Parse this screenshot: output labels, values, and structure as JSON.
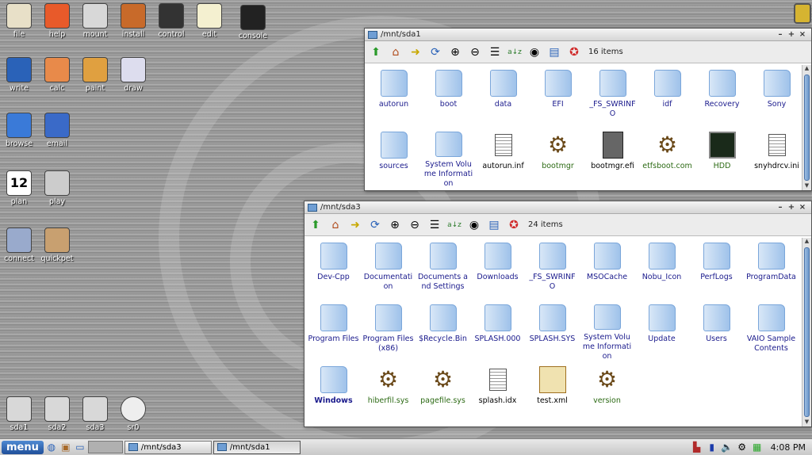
{
  "desktop_icons": [
    {
      "label": "file",
      "icon": "home-icon"
    },
    {
      "label": "help",
      "icon": "lifebuoy-icon"
    },
    {
      "label": "mount",
      "icon": "drive-icon"
    },
    {
      "label": "install",
      "icon": "package-icon"
    },
    {
      "label": "control",
      "icon": "hat-icon"
    },
    {
      "label": "edit",
      "icon": "notepad-icon"
    },
    {
      "label": "console",
      "icon": "terminal-icon"
    },
    {
      "label": "write",
      "icon": "pen-icon"
    },
    {
      "label": "calc",
      "icon": "spreadsheet-icon"
    },
    {
      "label": "paint",
      "icon": "palette-icon"
    },
    {
      "label": "draw",
      "icon": "compass-icon"
    },
    {
      "label": "browse",
      "icon": "globe-icon"
    },
    {
      "label": "email",
      "icon": "mail-icon"
    },
    {
      "label": "plan",
      "icon": "calendar-icon",
      "text": "12"
    },
    {
      "label": "play",
      "icon": "speaker-icon"
    },
    {
      "label": "connect",
      "icon": "network-icon"
    },
    {
      "label": "quickpet",
      "icon": "box-icon"
    },
    {
      "label": "sda1",
      "icon": "drive-icon"
    },
    {
      "label": "sda2",
      "icon": "drive-icon"
    },
    {
      "label": "sda3",
      "icon": "drive-icon"
    },
    {
      "label": "sr0",
      "icon": "cd-icon"
    }
  ],
  "colors": {
    "folder": "#9fc2ea",
    "directory_text": "#1a1a8c",
    "executable_text": "#2c6a14",
    "menu": "#1f4f9a"
  },
  "window_sda1": {
    "title": "/mnt/sda1",
    "count": "16 items",
    "items": [
      {
        "name": "autorun",
        "type": "folder"
      },
      {
        "name": "boot",
        "type": "folder"
      },
      {
        "name": "data",
        "type": "folder"
      },
      {
        "name": "EFI",
        "type": "folder"
      },
      {
        "name": "_FS_SWRINFO",
        "type": "folder"
      },
      {
        "name": "idf",
        "type": "folder"
      },
      {
        "name": "Recovery",
        "type": "folder"
      },
      {
        "name": "Sony",
        "type": "folder"
      },
      {
        "name": "sources",
        "type": "folder"
      },
      {
        "name": "System Volume Information",
        "type": "folder"
      },
      {
        "name": "autorun.inf",
        "type": "doc"
      },
      {
        "name": "bootmgr",
        "type": "gear"
      },
      {
        "name": "bootmgr.efi",
        "type": "binary"
      },
      {
        "name": "etfsboot.com",
        "type": "gear"
      },
      {
        "name": "HDD",
        "type": "terminal"
      },
      {
        "name": "snyhdrcv.ini",
        "type": "doc"
      }
    ]
  },
  "window_sda3": {
    "title": "/mnt/sda3",
    "count": "24 items",
    "items": [
      {
        "name": "Dev-Cpp",
        "type": "folder"
      },
      {
        "name": "Documentation",
        "type": "folder"
      },
      {
        "name": "Documents and Settings",
        "type": "folder"
      },
      {
        "name": "Downloads",
        "type": "folder"
      },
      {
        "name": "_FS_SWRINFO",
        "type": "folder"
      },
      {
        "name": "MSOCache",
        "type": "folder"
      },
      {
        "name": "Nobu_Icon",
        "type": "folder"
      },
      {
        "name": "PerfLogs",
        "type": "folder"
      },
      {
        "name": "ProgramData",
        "type": "folder"
      },
      {
        "name": "Program Files",
        "type": "folder"
      },
      {
        "name": "Program Files (x86)",
        "type": "folder"
      },
      {
        "name": "$Recycle.Bin",
        "type": "folder"
      },
      {
        "name": "SPLASH.000",
        "type": "folder"
      },
      {
        "name": "SPLASH.SYS",
        "type": "folder"
      },
      {
        "name": "System Volume Information",
        "type": "folder"
      },
      {
        "name": "Update",
        "type": "folder"
      },
      {
        "name": "Users",
        "type": "folder"
      },
      {
        "name": "VAIO Sample Contents",
        "type": "folder"
      },
      {
        "name": "Windows",
        "type": "folder",
        "bold": true
      },
      {
        "name": "hiberfil.sys",
        "type": "gear"
      },
      {
        "name": "pagefile.sys",
        "type": "gear"
      },
      {
        "name": "splash.idx",
        "type": "doc"
      },
      {
        "name": "test.xml",
        "type": "xml"
      },
      {
        "name": "version",
        "type": "gear"
      }
    ]
  },
  "taskbar": {
    "menu": "menu",
    "tasks": [
      "/mnt/sda3",
      "/mnt/sda1"
    ],
    "clock": "4:08 PM"
  }
}
